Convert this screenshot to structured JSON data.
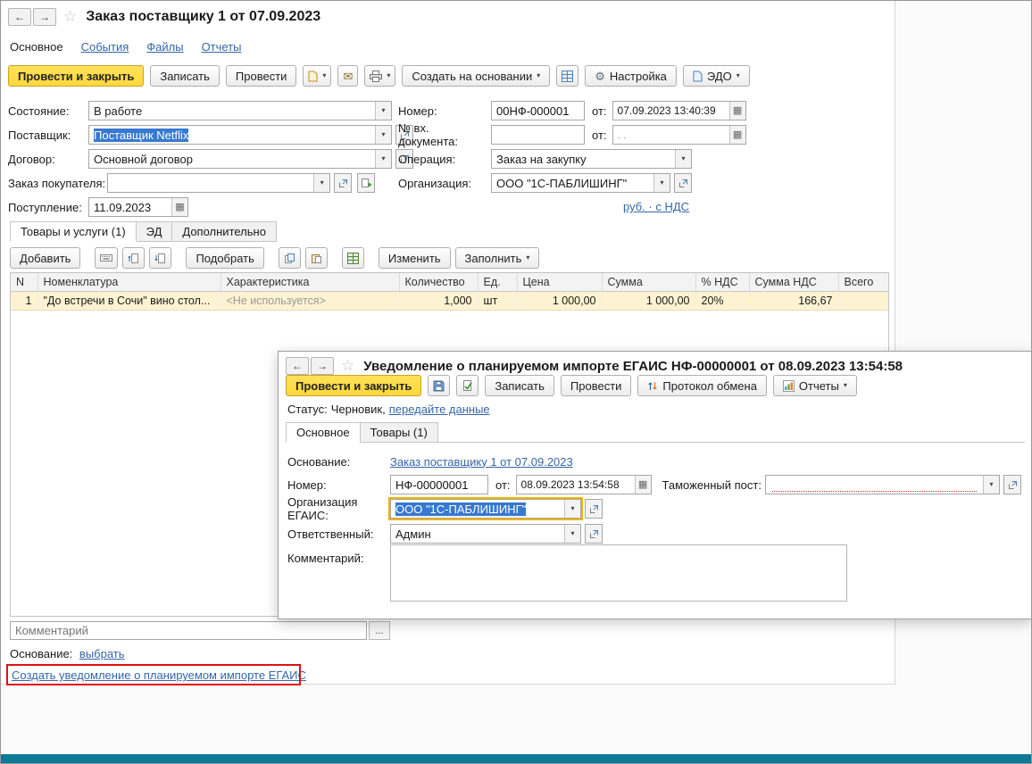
{
  "colors": {
    "accent_yellow": "#ffd83d",
    "accent_yellow_border": "#c9a227",
    "link_blue": "#3567a8",
    "selection_blue": "#3779d0",
    "row_highlight": "#fdf3d2",
    "highlight_red": "#e01010",
    "focus_orange": "#efb400",
    "taskbar_teal": "#0e7996"
  },
  "main": {
    "title": "Заказ поставщику 1 от 07.09.2023",
    "nav_tabs": {
      "main": "Основное",
      "events": "События",
      "files": "Файлы",
      "reports": "Отчеты"
    },
    "toolbar": {
      "post_close": "Провести и закрыть",
      "save": "Записать",
      "post": "Провести",
      "create_based_on": "Создать на основании",
      "settings": "Настройка",
      "edo": "ЭДО"
    },
    "form": {
      "state_label": "Состояние:",
      "state_value": "В работе",
      "supplier_label": "Поставщик:",
      "supplier_value": "Поставщик Netflix",
      "contract_label": "Договор:",
      "contract_value": "Основной договор",
      "customer_order_label": "Заказ покупателя:",
      "receipt_label": "Поступление:",
      "receipt_value": "11.09.2023",
      "number_label": "Номер:",
      "number_value": "00НФ-000001",
      "number_from_label": "от:",
      "number_date": "07.09.2023 13:40:39",
      "incoming_label": "№ вх. документа:",
      "incoming_from_label": "от:",
      "incoming_date_placeholder": ".  .",
      "operation_label": "Операция:",
      "operation_value": "Заказ на закупку",
      "org_label": "Организация:",
      "org_value": "ООО \"1С-ПАБЛИШИНГ\"",
      "currency_link": "руб. · с НДС"
    },
    "item_tabs": {
      "goods": "Товары и услуги (1)",
      "ed": "ЭД",
      "extra": "Дополнительно"
    },
    "table_toolbar": {
      "add": "Добавить",
      "pick": "Подобрать",
      "edit": "Изменить",
      "fill": "Заполнить"
    },
    "table": {
      "headers": [
        "N",
        "Номенклатура",
        "Характеристика",
        "Количество",
        "Ед.",
        "Цена",
        "Сумма",
        "% НДС",
        "Сумма НДС",
        "Всего"
      ],
      "rows": [
        {
          "n": "1",
          "item": "\"До встречи в Сочи\" вино стол...",
          "characteristic": "<Не используется>",
          "qty": "1,000",
          "unit": "шт",
          "price": "1 000,00",
          "sum": "1 000,00",
          "vat": "20%",
          "vat_sum": "166,67",
          "total": ""
        }
      ]
    },
    "comment_placeholder": "Комментарий",
    "comment_more": "...",
    "basis_label": "Основание:",
    "basis_link": "выбрать",
    "create_egais_link": "Создать уведомление о планируемом импорте ЕГАИС"
  },
  "overlay": {
    "title": "Уведомление о планируемом импорте ЕГАИС НФ-00000001 от 08.09.2023 13:54:58",
    "toolbar": {
      "post_close": "Провести и закрыть",
      "save": "Записать",
      "post": "Провести",
      "exchange_protocol": "Протокол обмена",
      "reports": "Отчеты"
    },
    "status_label": "Статус:",
    "status_value": "Черновик,",
    "status_link": "передайте данные",
    "tabs": {
      "main": "Основное",
      "goods": "Товары (1)"
    },
    "form": {
      "basis_label": "Основание:",
      "basis_link": "Заказ поставщику 1 от 07.09.2023",
      "number_label": "Номер:",
      "number_value": "НФ-00000001",
      "from_label": "от:",
      "date_value": "08.09.2023 13:54:58",
      "customs_label": "Таможенный пост:",
      "org_label": "Организация ЕГАИС:",
      "org_value": "ООО \"1С-ПАБЛИШИНГ\"",
      "responsible_label": "Ответственный:",
      "responsible_value": "Админ",
      "comment_label": "Комментарий:"
    }
  }
}
